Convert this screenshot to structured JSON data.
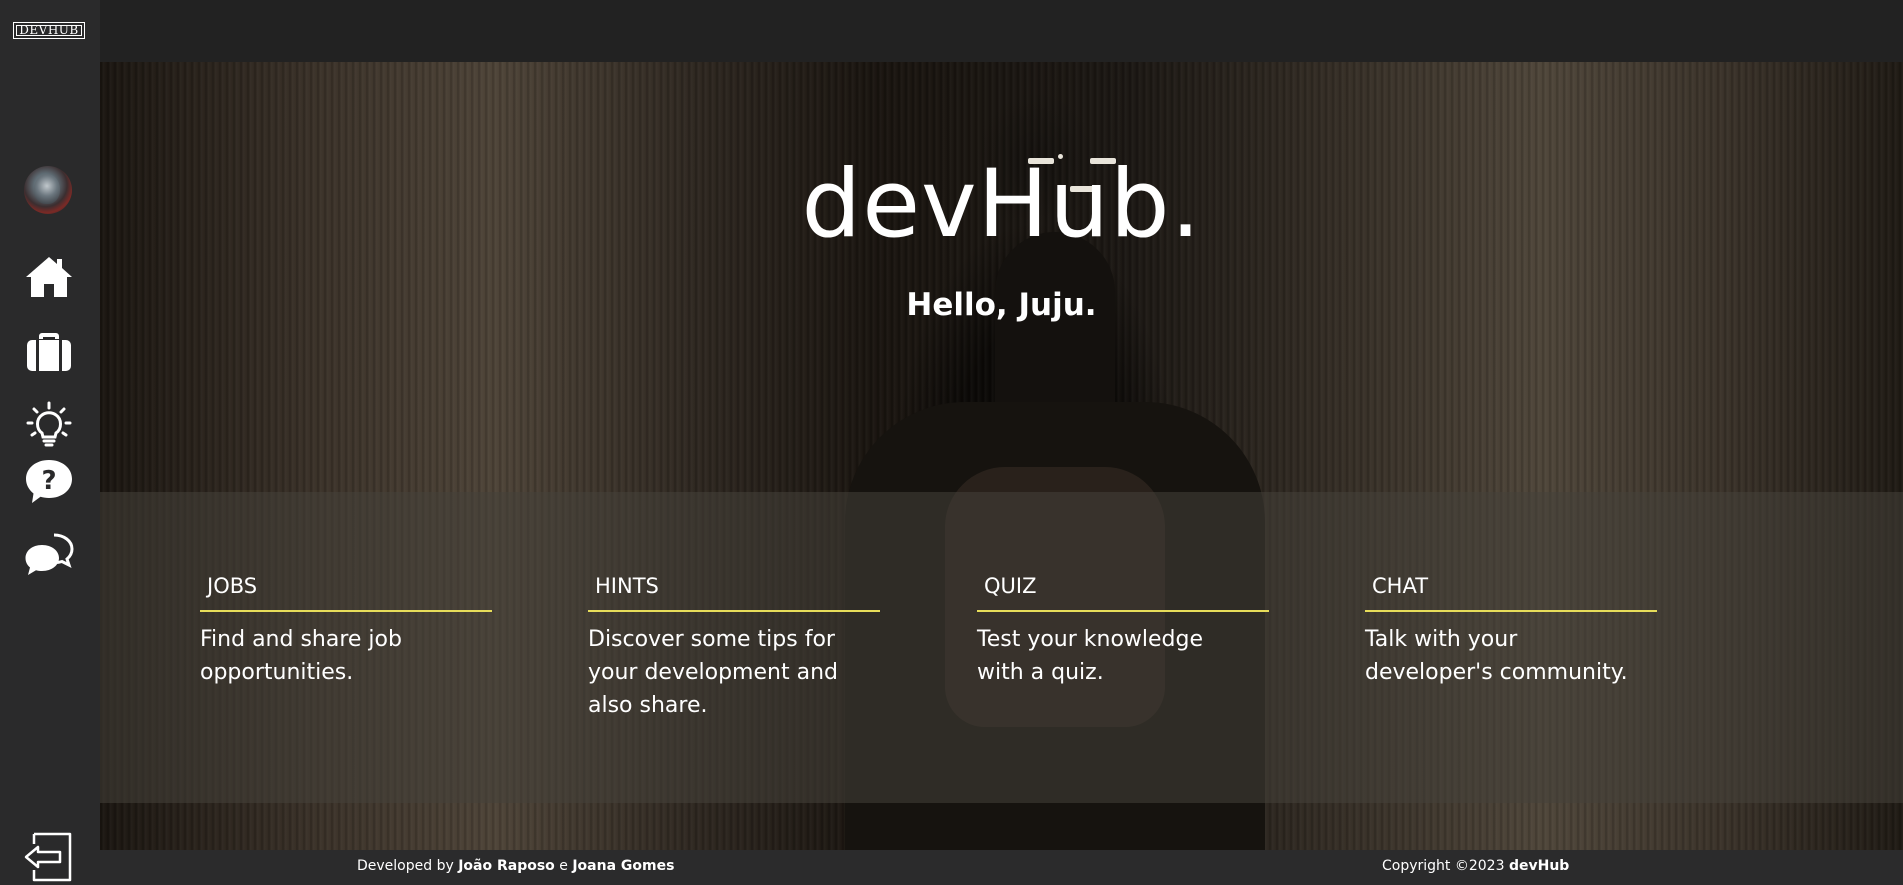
{
  "sidebar": {
    "logo_text": "DEVHUB",
    "items": [
      {
        "name": "avatar",
        "icon": "user-avatar"
      },
      {
        "name": "home",
        "icon": "home-icon"
      },
      {
        "name": "jobs",
        "icon": "briefcase-icon"
      },
      {
        "name": "hints",
        "icon": "lightbulb-icon"
      },
      {
        "name": "quiz",
        "icon": "question-bubble-icon"
      },
      {
        "name": "chat",
        "icon": "chat-bubbles-icon"
      }
    ],
    "logout_icon": "logout-icon"
  },
  "hero": {
    "title": "devHub.",
    "greeting": "Hello, Juju."
  },
  "features": [
    {
      "title": "JOBS",
      "description": "Find and share job opportunities."
    },
    {
      "title": "HINTS",
      "description": "Discover some tips for your development and also share."
    },
    {
      "title": "QUIZ",
      "description": "Test your knowledge with a quiz."
    },
    {
      "title": "CHAT",
      "description": "Talk with your developer's community."
    }
  ],
  "footer": {
    "developed_prefix": "Developed by",
    "developer_1": "João Raposo",
    "connector": "e",
    "developer_2": "Joana Gomes",
    "copyright_prefix": "Copyright ©2023",
    "brand": "devHub"
  },
  "colors": {
    "sidebar_bg": "#2a2a2b",
    "topbar_bg": "#222222",
    "accent_underline": "#e7dd5a",
    "text": "#ffffff"
  }
}
